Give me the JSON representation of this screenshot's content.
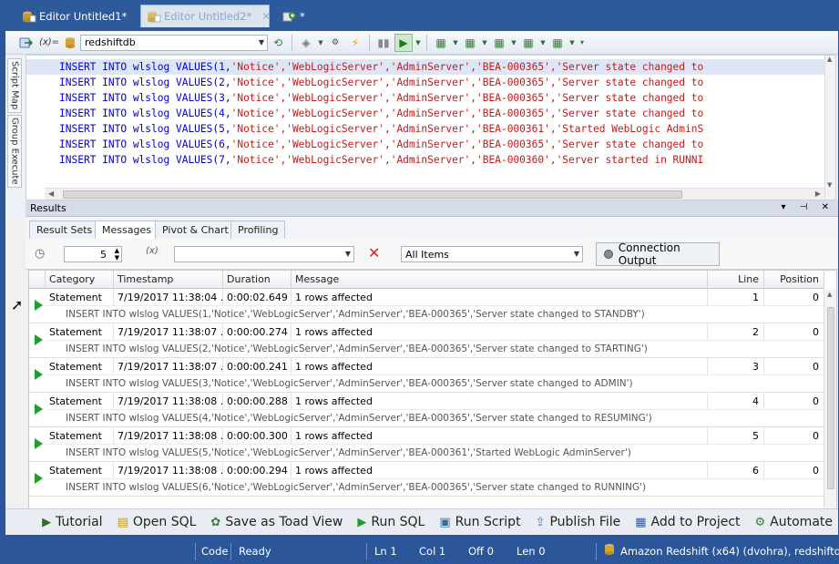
{
  "tabs": [
    {
      "label": "Editor Untitled1*",
      "active": false
    },
    {
      "label": "Editor Untitled2*",
      "active": true
    },
    {
      "label": "*",
      "active": false
    }
  ],
  "toolbar": {
    "connection_value": "redshiftdb",
    "var_label": "(x)="
  },
  "side_tabs": [
    "Script Map",
    "Group Execute"
  ],
  "editor": {
    "lines": [
      {
        "num": 1,
        "pre": "INSERT INTO wlslog VALUES(1,",
        "strs": "'Notice','WebLogicServer','AdminServer','BEA-000365','Server state changed to"
      },
      {
        "num": 2,
        "pre": "INSERT INTO wlslog VALUES(2,",
        "strs": "'Notice','WebLogicServer','AdminServer','BEA-000365','Server state changed to"
      },
      {
        "num": 3,
        "pre": "INSERT INTO wlslog VALUES(3,",
        "strs": "'Notice','WebLogicServer','AdminServer','BEA-000365','Server state changed to"
      },
      {
        "num": 4,
        "pre": "INSERT INTO wlslog VALUES(4,",
        "strs": "'Notice','WebLogicServer','AdminServer','BEA-000365','Server state changed to"
      },
      {
        "num": 5,
        "pre": "INSERT INTO wlslog VALUES(5,",
        "strs": "'Notice','WebLogicServer','AdminServer','BEA-000361','Started WebLogic AdminS"
      },
      {
        "num": 6,
        "pre": "INSERT INTO wlslog VALUES(6,",
        "strs": "'Notice','WebLogicServer','AdminServer','BEA-000365','Server state changed to"
      },
      {
        "num": 7,
        "pre": "INSERT INTO wlslog VALUES(7,",
        "strs": "'Notice','WebLogicServer','AdminServer','BEA-000360','Server started in RUNNI"
      }
    ]
  },
  "results": {
    "title": "Results",
    "tabs": [
      "Result Sets",
      "Messages",
      "Pivot & Chart",
      "Profiling"
    ],
    "active_tab": "Messages",
    "filter": {
      "count_value": "5",
      "items_value": "All Items",
      "connection_output_label": "Connection Output"
    },
    "columns": [
      "Category",
      "Timestamp",
      "Duration",
      "Message",
      "Line",
      "Position"
    ],
    "rows": [
      {
        "category": "Statement",
        "timestamp": "7/19/2017 11:38:04 ...",
        "duration": "0:00:02.649",
        "message": "1 rows affected",
        "line": "1",
        "position": "0",
        "sql": "INSERT INTO wlslog VALUES(1,'Notice','WebLogicServer','AdminServer','BEA-000365','Server state changed to STANDBY')"
      },
      {
        "category": "Statement",
        "timestamp": "7/19/2017 11:38:07 ...",
        "duration": "0:00:00.274",
        "message": "1 rows affected",
        "line": "2",
        "position": "0",
        "sql": "INSERT INTO wlslog VALUES(2,'Notice','WebLogicServer','AdminServer','BEA-000365','Server state changed to STARTING')"
      },
      {
        "category": "Statement",
        "timestamp": "7/19/2017 11:38:07 ...",
        "duration": "0:00:00.241",
        "message": "1 rows affected",
        "line": "3",
        "position": "0",
        "sql": "INSERT INTO wlslog VALUES(3,'Notice','WebLogicServer','AdminServer','BEA-000365','Server state changed to ADMIN')"
      },
      {
        "category": "Statement",
        "timestamp": "7/19/2017 11:38:08 ...",
        "duration": "0:00:00.288",
        "message": "1 rows affected",
        "line": "4",
        "position": "0",
        "sql": "INSERT INTO wlslog VALUES(4,'Notice','WebLogicServer','AdminServer','BEA-000365','Server state changed to RESUMING')"
      },
      {
        "category": "Statement",
        "timestamp": "7/19/2017 11:38:08 ...",
        "duration": "0:00:00.300",
        "message": "1 rows affected",
        "line": "5",
        "position": "0",
        "sql": "INSERT INTO wlslog VALUES(5,'Notice','WebLogicServer','AdminServer','BEA-000361','Started WebLogic AdminServer')"
      },
      {
        "category": "Statement",
        "timestamp": "7/19/2017 11:38:08 ...",
        "duration": "0:00:00.294",
        "message": "1 rows affected",
        "line": "6",
        "position": "0",
        "sql": "INSERT INTO wlslog VALUES(6,'Notice','WebLogicServer','AdminServer','BEA-000365','Server state changed to RUNNING')"
      }
    ]
  },
  "bottom_actions": [
    {
      "label": "Tutorial",
      "icon": "tutorial-icon"
    },
    {
      "label": "Open SQL",
      "icon": "open-sql-icon"
    },
    {
      "label": "Save as Toad View",
      "icon": "toad-view-icon"
    },
    {
      "label": "Run SQL",
      "icon": "run-icon"
    },
    {
      "label": "Run Script",
      "icon": "run-script-icon"
    },
    {
      "label": "Publish File",
      "icon": "publish-icon"
    },
    {
      "label": "Add to Project",
      "icon": "project-icon"
    },
    {
      "label": "Automate",
      "icon": "automate-icon"
    }
  ],
  "status": {
    "code": "Code",
    "state": "Ready",
    "ln": "Ln 1",
    "col": "Col 1",
    "off": "Off 0",
    "len": "Len 0",
    "connection": "Amazon Redshift (x64) (dvohra), redshiftdb"
  },
  "colors": {
    "accent": "#2b579a",
    "keyword": "#0000cc",
    "string": "#c41a16",
    "run_green": "#1f9e2e"
  }
}
